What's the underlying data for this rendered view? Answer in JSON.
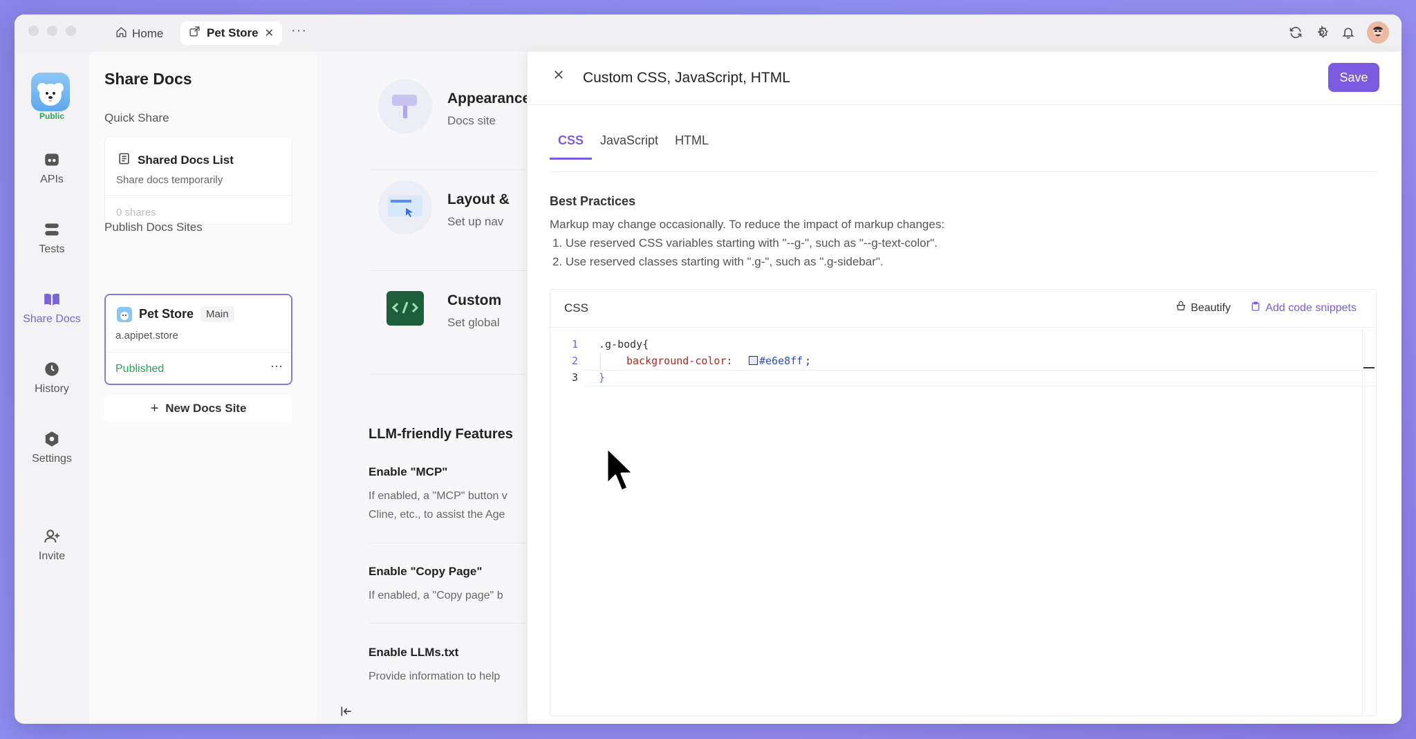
{
  "titlebar": {
    "tabs": [
      {
        "label": "Home"
      },
      {
        "label": "Pet Store"
      }
    ],
    "more": "···"
  },
  "nav": {
    "project_badge": "Public",
    "items": [
      {
        "label": "APIs"
      },
      {
        "label": "Tests"
      },
      {
        "label": "Share Docs",
        "active": true
      },
      {
        "label": "History"
      },
      {
        "label": "Settings"
      },
      {
        "label": "Invite"
      }
    ]
  },
  "share_panel": {
    "title": "Share Docs",
    "quick_share_heading": "Quick Share",
    "shared_docs_title": "Shared Docs List",
    "shared_docs_desc": "Share docs temporarily",
    "shares_count": "0 shares",
    "publish_heading": "Publish Docs Sites",
    "site_name": "Pet Store",
    "site_branch": "Main",
    "site_domain": "a.apipet.store",
    "site_status": "Published",
    "site_more": "···",
    "new_site_label": "New Docs Site"
  },
  "middle": {
    "rows": [
      {
        "title": "Appearance",
        "desc": "Docs site"
      },
      {
        "title": "Layout &",
        "desc": "Set up nav"
      },
      {
        "title": "Custom",
        "desc": "Set global"
      }
    ],
    "llm_title": "LLM-friendly Features",
    "features": [
      {
        "title": "Enable \"MCP\"",
        "lines": [
          "If enabled, a \"MCP\" button v",
          "Cline, etc., to assist the Age"
        ]
      },
      {
        "title": "Enable \"Copy Page\"",
        "lines": [
          "If enabled, a \"Copy page\" b"
        ]
      },
      {
        "title": "Enable LLMs.txt",
        "lines": [
          "Provide information to help"
        ]
      }
    ]
  },
  "drawer": {
    "title": "Custom CSS, JavaScript, HTML",
    "save_label": "Save",
    "tabs": [
      "CSS",
      "JavaScript",
      "HTML"
    ],
    "active_tab": "CSS",
    "best_practices_title": "Best Practices",
    "best_practices_lines": [
      "Markup may change occasionally. To reduce the impact of markup changes:",
      "1. Use reserved CSS variables starting with \"--g-\", such as \"--g-text-color\".",
      "2. Use reserved classes starting with \".g-\", such as \".g-sidebar\"."
    ],
    "editor_label": "CSS",
    "beautify_label": "Beautify",
    "add_snippets_label": "Add code snippets",
    "code_lines": [
      {
        "num": "1",
        "text": ".g-body{"
      },
      {
        "num": "2",
        "prop": "background-color:",
        "value": "#e6e8ff",
        "end": ";"
      },
      {
        "num": "3",
        "text": "}"
      }
    ]
  },
  "colors": {
    "accent": "#7b5be0",
    "published": "#27a35a",
    "code_property": "#b3261e",
    "code_value": "#2b4fc7"
  }
}
